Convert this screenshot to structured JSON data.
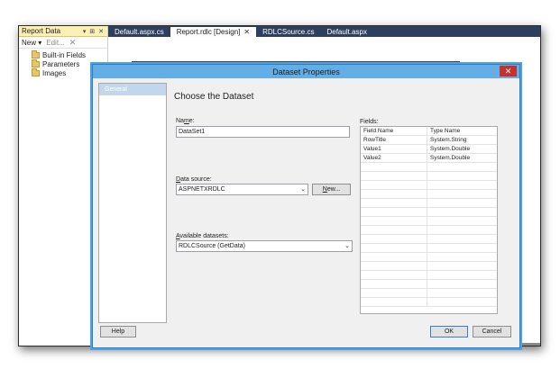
{
  "report_data": {
    "title": "Report Data",
    "pin": "▾ ⊞ ✕",
    "toolbar": {
      "new": "New ▾",
      "edit": "Edit...",
      "delete": "✕"
    },
    "items": [
      "Built-in Fields",
      "Parameters",
      "Images"
    ]
  },
  "tabs": [
    {
      "label": "Default.aspx.cs"
    },
    {
      "label": "Report.rdlc [Design]",
      "close": "✕"
    },
    {
      "label": "RDLCSource.cs"
    },
    {
      "label": "Default.aspx"
    }
  ],
  "dialog": {
    "title": "Dataset Properties",
    "close": "✕",
    "sidebar": {
      "general": "General"
    },
    "heading": "Choose the Dataset",
    "name": {
      "label_pre": "Na",
      "label_u": "m",
      "label_post": "e:",
      "value": "DataSet1"
    },
    "data_source": {
      "label_u": "D",
      "label_post": "ata source:",
      "value": "ASPNETXRDLC",
      "new_pre": "N",
      "new_post": "ew..."
    },
    "available": {
      "label_u": "A",
      "label_post": "vailable datasets:",
      "value": "RDLCSource (GetData)"
    },
    "fields": {
      "label": "Fields:",
      "headers": [
        "Field Name",
        "Type Name"
      ],
      "rows": [
        [
          "RowTitle",
          "System.String"
        ],
        [
          "Value1",
          "System.Double"
        ],
        [
          "Value2",
          "System.Double"
        ]
      ]
    },
    "help": "Help",
    "ok": "OK",
    "cancel": "Cancel"
  }
}
